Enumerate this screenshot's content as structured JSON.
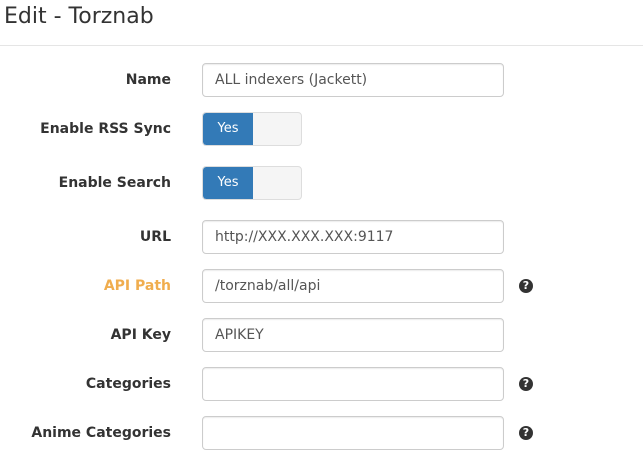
{
  "header": {
    "title": "Edit - Torznab"
  },
  "form": {
    "name": {
      "label": "Name",
      "value": "ALL indexers (Jackett)"
    },
    "rss_sync": {
      "label": "Enable RSS Sync",
      "toggle_label": "Yes",
      "enabled": true
    },
    "search": {
      "label": "Enable Search",
      "toggle_label": "Yes",
      "enabled": true
    },
    "url": {
      "label": "URL",
      "value": "http://XXX.XXX.XXX:9117"
    },
    "api_path": {
      "label": "API Path",
      "value": "/torznab/all/api",
      "help_icon": "question-circle"
    },
    "api_key": {
      "label": "API Key",
      "value": "APIKEY"
    },
    "categories": {
      "label": "Categories",
      "value": "",
      "help_icon": "question-circle"
    },
    "anime_categories": {
      "label": "Anime Categories",
      "value": "",
      "help_icon": "question-circle"
    }
  },
  "colors": {
    "primary": "#337ab7",
    "warning_label": "#f0ad4e"
  }
}
